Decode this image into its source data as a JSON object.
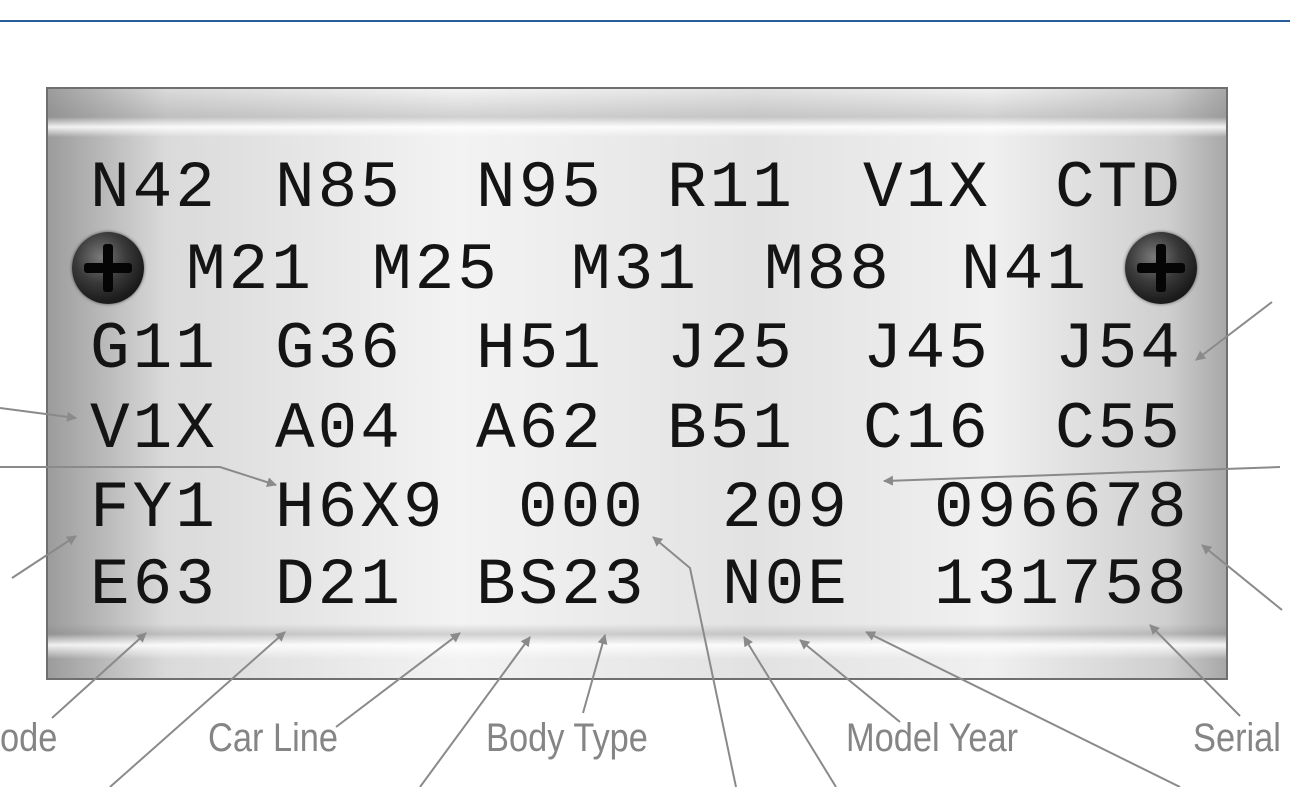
{
  "plate": {
    "rows": [
      [
        "N42",
        "N85",
        "N95",
        "R11",
        "V1X",
        "CTD"
      ],
      [
        "M21",
        "M25",
        "M31",
        "M88",
        "N41"
      ],
      [
        "G11",
        "G36",
        "H51",
        "J25",
        "J45",
        "J54"
      ],
      [
        "V1X",
        "A04",
        "A62",
        "B51",
        "C16",
        "C55"
      ],
      [
        "FY1",
        "H6X9",
        "000",
        "209",
        "096678"
      ],
      [
        "E63",
        "D21",
        "BS23",
        "N0E",
        "131758"
      ]
    ]
  },
  "labels": {
    "code_partial": "ode",
    "car_line": "Car Line",
    "body_type": "Body Type",
    "model_year": "Model Year",
    "serial_partial": "Serial"
  },
  "colors": {
    "top_rule": "#2a5d9b",
    "label_text": "#858585",
    "arrow": "#8a8a8a",
    "plate_text": "#141414"
  }
}
